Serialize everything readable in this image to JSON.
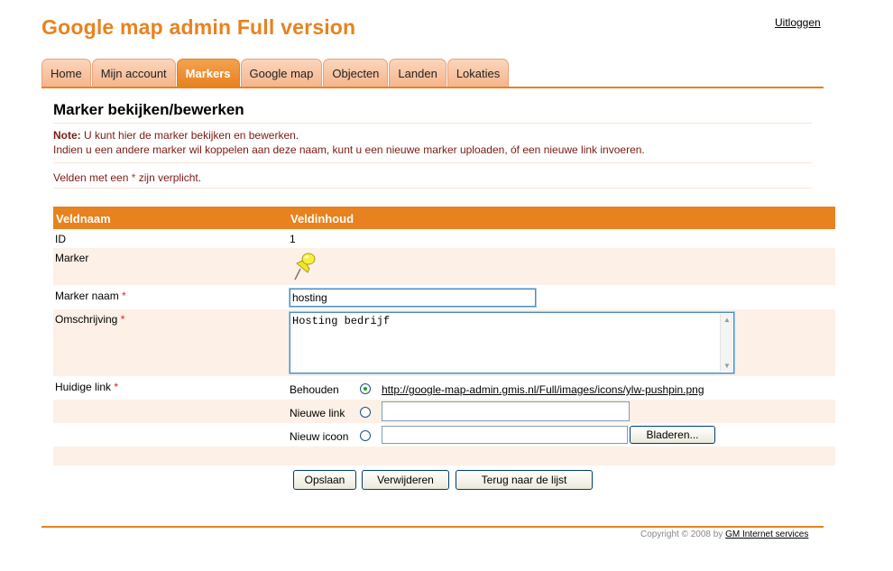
{
  "app": {
    "title": "Google map admin Full version",
    "logout": "Uitloggen"
  },
  "tabs": [
    {
      "label": "Home",
      "active": false
    },
    {
      "label": "Mijn account",
      "active": false
    },
    {
      "label": "Markers",
      "active": true
    },
    {
      "label": "Google map",
      "active": false
    },
    {
      "label": "Objecten",
      "active": false
    },
    {
      "label": "Landen",
      "active": false
    },
    {
      "label": "Lokaties",
      "active": false
    }
  ],
  "page": {
    "heading": "Marker bekijken/bewerken",
    "note_label": "Note:",
    "note_line1": " U kunt hier de marker bekijken en bewerken.",
    "note_line2": "Indien u een andere marker wil koppelen aan deze naam, kunt u een nieuwe marker uploaden, óf een nieuwe link invoeren.",
    "required_prefix": "Velden met een ",
    "required_star": "*",
    "required_suffix": " zijn verplicht."
  },
  "table": {
    "headers": [
      "Veldnaam",
      "Veldinhoud"
    ],
    "id_label": "ID",
    "id_value": "1",
    "marker_label": "Marker",
    "marker_icon": "yellow-pushpin-icon",
    "name_label": "Marker naam",
    "name_value": "hosting",
    "desc_label": "Omschrijving",
    "desc_value": "Hosting bedrijf",
    "link_label": "Huidige link",
    "required_star": "*",
    "options": {
      "keep_label": "Behouden",
      "keep_url": "http://google-map-admin.gmis.nl/Full/images/icons/ylw-pushpin.png",
      "new_link_label": "Nieuwe link",
      "new_link_value": "",
      "new_icon_label": "Nieuw icoon",
      "new_icon_value": "",
      "browse_label": "Bladeren..."
    }
  },
  "actions": {
    "save": "Opslaan",
    "delete": "Verwijderen",
    "back": "Terug naar de lijst"
  },
  "footer": {
    "copyright": "Copyright © 2008 by ",
    "company": "GM Internet services"
  },
  "colors": {
    "accent": "#e8821f",
    "row_alt": "#fdf0e6",
    "note_text": "#7a1a12"
  }
}
